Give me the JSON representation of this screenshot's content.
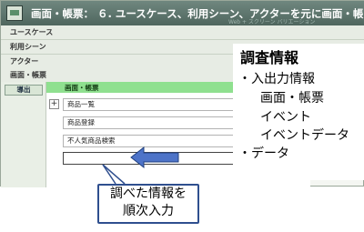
{
  "window": {
    "title": "画面・帳票： ６. ユースケース、利用シーン、アクターを元に画面・帳",
    "faint_overlay": "Web + スクリーン バリエーション"
  },
  "nav": {
    "items": [
      "ユースケース",
      "利用シーン",
      "アクター",
      "画面・帳票"
    ]
  },
  "left_panel": {
    "button_label": "導出"
  },
  "main": {
    "header": "画面・帳票",
    "expand_symbol": "+",
    "rows": [
      "商品一覧",
      "商品登録",
      "不人気商品検索",
      ""
    ]
  },
  "info": {
    "title": "調査情報",
    "lines": [
      "・入出力情報",
      "画面・帳票",
      "イベント",
      "イベントデータ",
      "・データ"
    ]
  },
  "callout": {
    "line1": "調べた情報を",
    "line2": "順次入力"
  },
  "colors": {
    "titlebar": "#5b726a",
    "header_green": "#8fe08f",
    "arrow_blue": "#4d73c8",
    "arrow_outline": "#1f3f7f"
  }
}
